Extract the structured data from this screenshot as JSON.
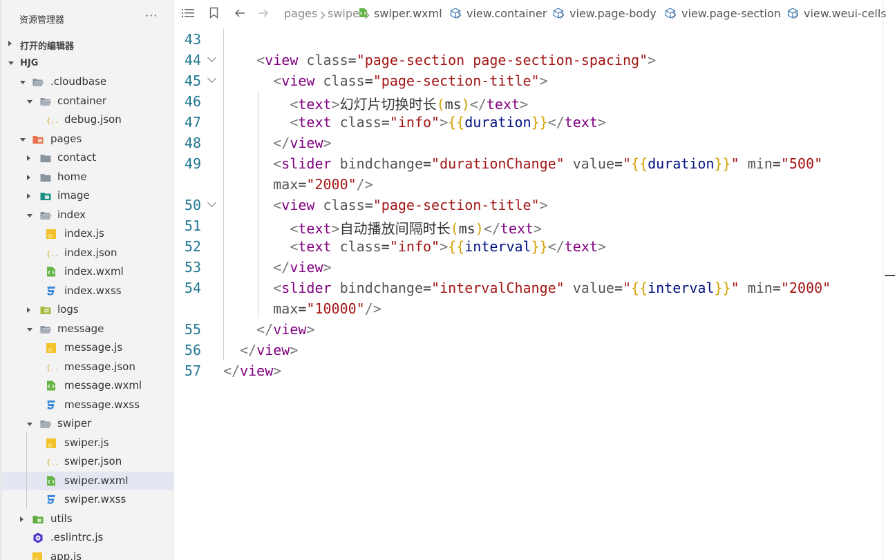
{
  "sidebar": {
    "title": "资源管理器",
    "more": "···",
    "open_editors": "打开的编辑器",
    "workspace": "HJG",
    "tree": [
      {
        "label": ".cloudbase",
        "icon": "folder-open-icon",
        "depth": 1,
        "expanded": true
      },
      {
        "label": "container",
        "icon": "folder-open-icon",
        "depth": 2,
        "expanded": true
      },
      {
        "label": "debug.json",
        "icon": "json-file-icon",
        "depth": 3
      },
      {
        "label": "pages",
        "icon": "pages-folder-icon",
        "depth": 1,
        "expanded": true
      },
      {
        "label": "contact",
        "icon": "folder-icon",
        "depth": 2,
        "expanded": false
      },
      {
        "label": "home",
        "icon": "folder-icon",
        "depth": 2,
        "expanded": false
      },
      {
        "label": "image",
        "icon": "image-folder-icon",
        "depth": 2,
        "expanded": false
      },
      {
        "label": "index",
        "icon": "folder-open-icon",
        "depth": 2,
        "expanded": true
      },
      {
        "label": "index.js",
        "icon": "js-file-icon",
        "depth": 3
      },
      {
        "label": "index.json",
        "icon": "json-file-icon",
        "depth": 3
      },
      {
        "label": "index.wxml",
        "icon": "wxml-file-icon",
        "depth": 3
      },
      {
        "label": "index.wxss",
        "icon": "wxss-file-icon",
        "depth": 3
      },
      {
        "label": "logs",
        "icon": "logs-folder-icon",
        "depth": 2,
        "expanded": false
      },
      {
        "label": "message",
        "icon": "folder-open-icon",
        "depth": 2,
        "expanded": true
      },
      {
        "label": "message.js",
        "icon": "js-file-icon",
        "depth": 3
      },
      {
        "label": "message.json",
        "icon": "json-file-icon",
        "depth": 3
      },
      {
        "label": "message.wxml",
        "icon": "wxml-file-icon",
        "depth": 3
      },
      {
        "label": "message.wxss",
        "icon": "wxss-file-icon",
        "depth": 3
      },
      {
        "label": "swiper",
        "icon": "folder-open-icon",
        "depth": 2,
        "expanded": true
      },
      {
        "label": "swiper.js",
        "icon": "js-file-icon",
        "depth": 3
      },
      {
        "label": "swiper.json",
        "icon": "json-file-icon",
        "depth": 3
      },
      {
        "label": "swiper.wxml",
        "icon": "wxml-file-icon",
        "depth": 3,
        "selected": true
      },
      {
        "label": "swiper.wxss",
        "icon": "wxss-file-icon",
        "depth": 3
      },
      {
        "label": "utils",
        "icon": "utils-folder-icon",
        "depth": 1,
        "expanded": false
      },
      {
        "label": ".eslintrc.js",
        "icon": "eslint-file-icon",
        "depth": 1
      },
      {
        "label": "app.js",
        "icon": "js-file-icon",
        "depth": 1
      }
    ]
  },
  "breadcrumb": {
    "items": [
      {
        "label": "pages",
        "type": "folder"
      },
      {
        "label": "swiper",
        "type": "folder"
      },
      {
        "label": "swiper.wxml",
        "type": "file"
      },
      {
        "label": "view.container",
        "type": "symbol"
      },
      {
        "label": "view.page-body",
        "type": "symbol"
      },
      {
        "label": "view.page-section",
        "type": "symbol"
      },
      {
        "label": "view.weui-cells",
        "type": "symbol"
      }
    ]
  },
  "editor": {
    "lines": [
      {
        "num": "43",
        "fold": false
      },
      {
        "num": "44",
        "fold": true
      },
      {
        "num": "45",
        "fold": true
      },
      {
        "num": "46",
        "fold": false
      },
      {
        "num": "47",
        "fold": false
      },
      {
        "num": "48",
        "fold": false
      },
      {
        "num": "49",
        "fold": false
      },
      {
        "num": "",
        "fold": false
      },
      {
        "num": "50",
        "fold": true
      },
      {
        "num": "51",
        "fold": false
      },
      {
        "num": "52",
        "fold": false
      },
      {
        "num": "53",
        "fold": false
      },
      {
        "num": "54",
        "fold": false
      },
      {
        "num": "",
        "fold": false
      },
      {
        "num": "55",
        "fold": false
      },
      {
        "num": "56",
        "fold": false
      },
      {
        "num": "57",
        "fold": false
      }
    ],
    "code": [
      [],
      [
        {
          "t": "    "
        },
        {
          "t": "<",
          "c": "br"
        },
        {
          "t": "view",
          "c": "tag"
        },
        {
          "t": " class",
          "c": "attr"
        },
        {
          "t": "=",
          "c": "eq"
        },
        {
          "t": "\"page-section page-section-spacing\"",
          "c": "str"
        },
        {
          "t": ">",
          "c": "br"
        }
      ],
      [
        {
          "t": "      "
        },
        {
          "t": "<",
          "c": "br"
        },
        {
          "t": "view",
          "c": "tag"
        },
        {
          "t": " class",
          "c": "attr"
        },
        {
          "t": "=",
          "c": "eq"
        },
        {
          "t": "\"page-section-title\"",
          "c": "str"
        },
        {
          "t": ">",
          "c": "br"
        }
      ],
      [
        {
          "t": "        "
        },
        {
          "t": "<",
          "c": "br"
        },
        {
          "t": "text",
          "c": "tag"
        },
        {
          "t": ">",
          "c": "br"
        },
        {
          "t": "幻灯片切换时长",
          "c": "zh"
        },
        {
          "t": "(",
          "c": "sb"
        },
        {
          "t": "ms",
          "c": "zh"
        },
        {
          "t": ")",
          "c": "sb"
        },
        {
          "t": "</",
          "c": "br"
        },
        {
          "t": "text",
          "c": "tag"
        },
        {
          "t": ">",
          "c": "br"
        }
      ],
      [
        {
          "t": "        "
        },
        {
          "t": "<",
          "c": "br"
        },
        {
          "t": "text",
          "c": "tag"
        },
        {
          "t": " class",
          "c": "attr"
        },
        {
          "t": "=",
          "c": "eq"
        },
        {
          "t": "\"info\"",
          "c": "str"
        },
        {
          "t": ">",
          "c": "br"
        },
        {
          "t": "{{",
          "c": "sb"
        },
        {
          "t": "duration",
          "c": "var"
        },
        {
          "t": "}}",
          "c": "sb"
        },
        {
          "t": "</",
          "c": "br"
        },
        {
          "t": "text",
          "c": "tag"
        },
        {
          "t": ">",
          "c": "br"
        }
      ],
      [
        {
          "t": "      "
        },
        {
          "t": "</",
          "c": "br"
        },
        {
          "t": "view",
          "c": "tag"
        },
        {
          "t": ">",
          "c": "br"
        }
      ],
      [
        {
          "t": "      "
        },
        {
          "t": "<",
          "c": "br"
        },
        {
          "t": "slider",
          "c": "tag"
        },
        {
          "t": " bindchange",
          "c": "attr"
        },
        {
          "t": "=",
          "c": "eq"
        },
        {
          "t": "\"durationChange\"",
          "c": "str"
        },
        {
          "t": " value",
          "c": "attr"
        },
        {
          "t": "=",
          "c": "eq"
        },
        {
          "t": "\"",
          "c": "str"
        },
        {
          "t": "{{",
          "c": "sb"
        },
        {
          "t": "duration",
          "c": "var"
        },
        {
          "t": "}}",
          "c": "sb"
        },
        {
          "t": "\"",
          "c": "str"
        },
        {
          "t": " min",
          "c": "attr"
        },
        {
          "t": "=",
          "c": "eq"
        },
        {
          "t": "\"500\"",
          "c": "str"
        }
      ],
      [
        {
          "t": "      "
        },
        {
          "t": "max",
          "c": "attr"
        },
        {
          "t": "=",
          "c": "eq"
        },
        {
          "t": "\"2000\"",
          "c": "str"
        },
        {
          "t": "/>",
          "c": "br"
        }
      ],
      [
        {
          "t": "      "
        },
        {
          "t": "<",
          "c": "br"
        },
        {
          "t": "view",
          "c": "tag"
        },
        {
          "t": " class",
          "c": "attr"
        },
        {
          "t": "=",
          "c": "eq"
        },
        {
          "t": "\"page-section-title\"",
          "c": "str"
        },
        {
          "t": ">",
          "c": "br"
        }
      ],
      [
        {
          "t": "        "
        },
        {
          "t": "<",
          "c": "br"
        },
        {
          "t": "text",
          "c": "tag"
        },
        {
          "t": ">",
          "c": "br"
        },
        {
          "t": "自动播放间隔时长",
          "c": "zh"
        },
        {
          "t": "(",
          "c": "sb"
        },
        {
          "t": "ms",
          "c": "zh"
        },
        {
          "t": ")",
          "c": "sb"
        },
        {
          "t": "</",
          "c": "br"
        },
        {
          "t": "text",
          "c": "tag"
        },
        {
          "t": ">",
          "c": "br"
        }
      ],
      [
        {
          "t": "        "
        },
        {
          "t": "<",
          "c": "br"
        },
        {
          "t": "text",
          "c": "tag"
        },
        {
          "t": " class",
          "c": "attr"
        },
        {
          "t": "=",
          "c": "eq"
        },
        {
          "t": "\"info\"",
          "c": "str"
        },
        {
          "t": ">",
          "c": "br"
        },
        {
          "t": "{{",
          "c": "sb"
        },
        {
          "t": "interval",
          "c": "var"
        },
        {
          "t": "}}",
          "c": "sb"
        },
        {
          "t": "</",
          "c": "br"
        },
        {
          "t": "text",
          "c": "tag"
        },
        {
          "t": ">",
          "c": "br"
        }
      ],
      [
        {
          "t": "      "
        },
        {
          "t": "</",
          "c": "br"
        },
        {
          "t": "view",
          "c": "tag"
        },
        {
          "t": ">",
          "c": "br"
        }
      ],
      [
        {
          "t": "      "
        },
        {
          "t": "<",
          "c": "br"
        },
        {
          "t": "slider",
          "c": "tag"
        },
        {
          "t": " bindchange",
          "c": "attr"
        },
        {
          "t": "=",
          "c": "eq"
        },
        {
          "t": "\"intervalChange\"",
          "c": "str"
        },
        {
          "t": " value",
          "c": "attr"
        },
        {
          "t": "=",
          "c": "eq"
        },
        {
          "t": "\"",
          "c": "str"
        },
        {
          "t": "{{",
          "c": "sb"
        },
        {
          "t": "interval",
          "c": "var"
        },
        {
          "t": "}}",
          "c": "sb"
        },
        {
          "t": "\"",
          "c": "str"
        },
        {
          "t": " min",
          "c": "attr"
        },
        {
          "t": "=",
          "c": "eq"
        },
        {
          "t": "\"2000\"",
          "c": "str"
        }
      ],
      [
        {
          "t": "      "
        },
        {
          "t": "max",
          "c": "attr"
        },
        {
          "t": "=",
          "c": "eq"
        },
        {
          "t": "\"10000\"",
          "c": "str"
        },
        {
          "t": "/>",
          "c": "br"
        }
      ],
      [
        {
          "t": "    "
        },
        {
          "t": "</",
          "c": "br"
        },
        {
          "t": "view",
          "c": "tag"
        },
        {
          "t": ">",
          "c": "br"
        }
      ],
      [
        {
          "t": "  "
        },
        {
          "t": "</",
          "c": "br"
        },
        {
          "t": "view",
          "c": "tag"
        },
        {
          "t": ">",
          "c": "br"
        }
      ],
      [
        {
          "t": "</",
          "c": "br"
        },
        {
          "t": "view",
          "c": "tag"
        },
        {
          "t": ">",
          "c": "br"
        }
      ]
    ]
  },
  "colors": {
    "tag": "#800080",
    "string": "#a31515",
    "bracket": "#d4a000",
    "variable": "#001080",
    "line_number": "#237893",
    "selection": "#e4e6f1"
  }
}
